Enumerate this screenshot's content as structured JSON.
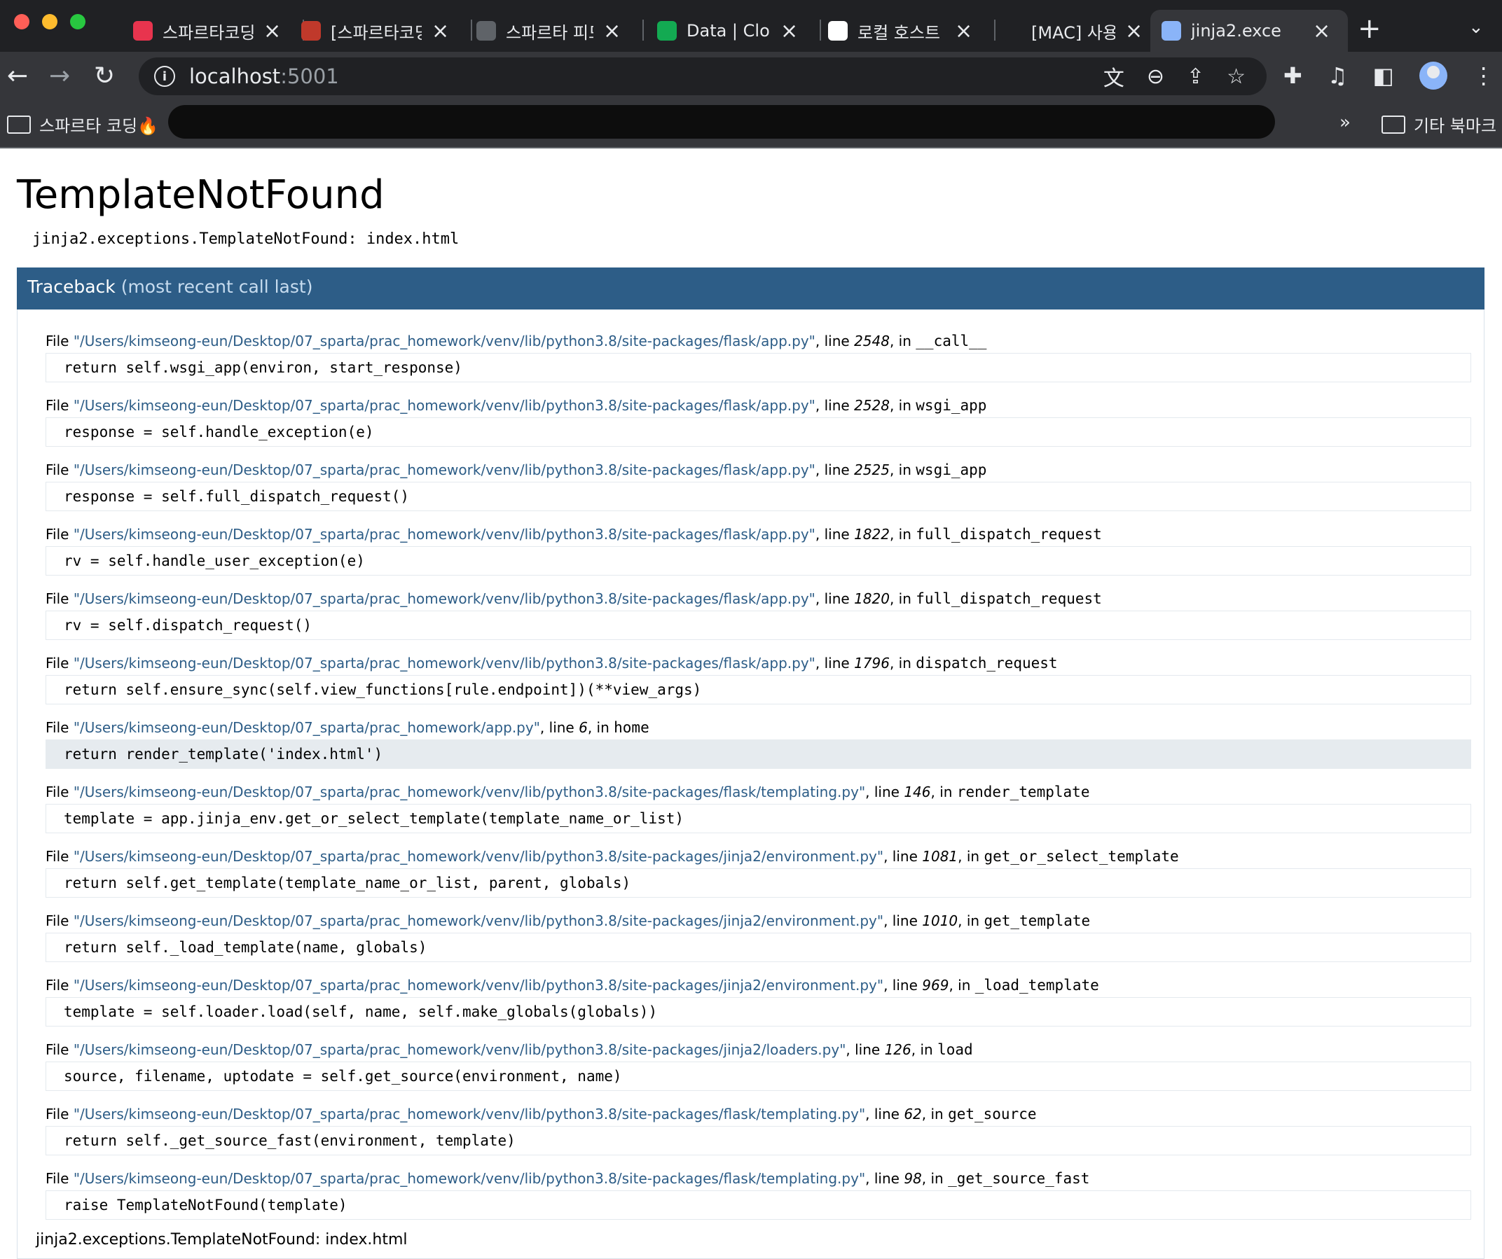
{
  "browser": {
    "tabs": [
      {
        "title": "스파르타코딩",
        "favicon_color": "#e8344e",
        "favicon_name": "sparta-heart-icon",
        "active": false
      },
      {
        "title": "[스파르타코딩",
        "favicon_color": "#c0392b",
        "favicon_name": "book-icon",
        "active": false
      },
      {
        "title": "스파르타 피드",
        "favicon_color": "#5f6368",
        "favicon_name": "globe-icon",
        "active": false
      },
      {
        "title": "Data | Clou",
        "favicon_color": "#13aa52",
        "favicon_name": "mongodb-leaf-icon",
        "active": false
      },
      {
        "title": "로컬 호스트",
        "favicon_color": "#ffffff",
        "favicon_name": "google-icon",
        "active": false
      },
      {
        "title": "[MAC] 사용",
        "favicon_color": "#202124",
        "favicon_name": "blank-icon",
        "active": false
      },
      {
        "title": "jinja2.exce",
        "favicon_color": "#8ab4f8",
        "favicon_name": "terminal-icon",
        "active": true
      }
    ],
    "address": {
      "host": "localhost",
      "port": ":5001"
    },
    "bookmarks": {
      "first": "스파르타 코딩🔥",
      "overflow": "»",
      "other": "기타 북마크"
    }
  },
  "page": {
    "title": "TemplateNotFound",
    "error_message": "jinja2.exceptions.TemplateNotFound: index.html",
    "traceback_label": "Traceback",
    "traceback_sub": "(most recent call last)",
    "frames": [
      {
        "file": "\"/Users/kimseong-eun/Desktop/07_sparta/prac_homework/venv/lib/python3.8/site-packages/flask/app.py\"",
        "line": "2548",
        "func": "__call__",
        "code": "return self.wsgi_app(environ, start_response)",
        "highlight": false
      },
      {
        "file": "\"/Users/kimseong-eun/Desktop/07_sparta/prac_homework/venv/lib/python3.8/site-packages/flask/app.py\"",
        "line": "2528",
        "func": "wsgi_app",
        "code": "response = self.handle_exception(e)",
        "highlight": false
      },
      {
        "file": "\"/Users/kimseong-eun/Desktop/07_sparta/prac_homework/venv/lib/python3.8/site-packages/flask/app.py\"",
        "line": "2525",
        "func": "wsgi_app",
        "code": "response = self.full_dispatch_request()",
        "highlight": false
      },
      {
        "file": "\"/Users/kimseong-eun/Desktop/07_sparta/prac_homework/venv/lib/python3.8/site-packages/flask/app.py\"",
        "line": "1822",
        "func": "full_dispatch_request",
        "code": "rv = self.handle_user_exception(e)",
        "highlight": false
      },
      {
        "file": "\"/Users/kimseong-eun/Desktop/07_sparta/prac_homework/venv/lib/python3.8/site-packages/flask/app.py\"",
        "line": "1820",
        "func": "full_dispatch_request",
        "code": "rv = self.dispatch_request()",
        "highlight": false
      },
      {
        "file": "\"/Users/kimseong-eun/Desktop/07_sparta/prac_homework/venv/lib/python3.8/site-packages/flask/app.py\"",
        "line": "1796",
        "func": "dispatch_request",
        "code": "return self.ensure_sync(self.view_functions[rule.endpoint])(**view_args)",
        "highlight": false
      },
      {
        "file": "\"/Users/kimseong-eun/Desktop/07_sparta/prac_homework/app.py\"",
        "line": "6",
        "func": "home",
        "code": "return render_template('index.html')",
        "highlight": true
      },
      {
        "file": "\"/Users/kimseong-eun/Desktop/07_sparta/prac_homework/venv/lib/python3.8/site-packages/flask/templating.py\"",
        "line": "146",
        "func": "render_template",
        "code": "template = app.jinja_env.get_or_select_template(template_name_or_list)",
        "highlight": false
      },
      {
        "file": "\"/Users/kimseong-eun/Desktop/07_sparta/prac_homework/venv/lib/python3.8/site-packages/jinja2/environment.py\"",
        "line": "1081",
        "func": "get_or_select_template",
        "code": "return self.get_template(template_name_or_list, parent, globals)",
        "highlight": false
      },
      {
        "file": "\"/Users/kimseong-eun/Desktop/07_sparta/prac_homework/venv/lib/python3.8/site-packages/jinja2/environment.py\"",
        "line": "1010",
        "func": "get_template",
        "code": "return self._load_template(name, globals)",
        "highlight": false
      },
      {
        "file": "\"/Users/kimseong-eun/Desktop/07_sparta/prac_homework/venv/lib/python3.8/site-packages/jinja2/environment.py\"",
        "line": "969",
        "func": "_load_template",
        "code": "template = self.loader.load(self, name, self.make_globals(globals))",
        "highlight": false
      },
      {
        "file": "\"/Users/kimseong-eun/Desktop/07_sparta/prac_homework/venv/lib/python3.8/site-packages/jinja2/loaders.py\"",
        "line": "126",
        "func": "load",
        "code": "source, filename, uptodate = self.get_source(environment, name)",
        "highlight": false
      },
      {
        "file": "\"/Users/kimseong-eun/Desktop/07_sparta/prac_homework/venv/lib/python3.8/site-packages/flask/templating.py\"",
        "line": "62",
        "func": "get_source",
        "code": "return self._get_source_fast(environment, template)",
        "highlight": false
      },
      {
        "file": "\"/Users/kimseong-eun/Desktop/07_sparta/prac_homework/venv/lib/python3.8/site-packages/flask/templating.py\"",
        "line": "98",
        "func": "_get_source_fast",
        "code": "raise TemplateNotFound(template)",
        "highlight": false
      }
    ],
    "labels": {
      "file": "File ",
      "line": ", line ",
      "in": ", in "
    },
    "final_message": "jinja2.exceptions.TemplateNotFound: index.html"
  }
}
